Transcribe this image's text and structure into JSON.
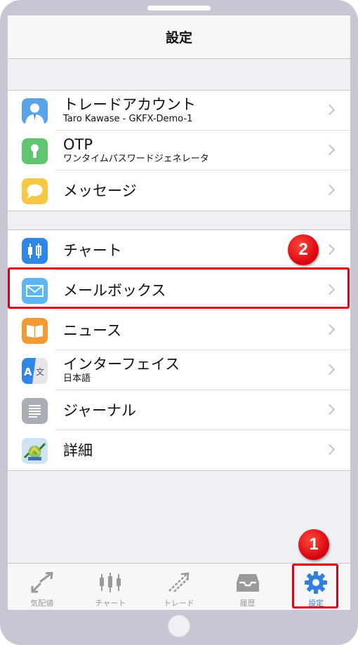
{
  "navbar": {
    "title": "設定"
  },
  "group1": [
    {
      "title": "トレードアカウント",
      "subtitle": "Taro Kawase - GKFX-Demo-1",
      "icon": "user-icon",
      "color": "#5ba3e8"
    },
    {
      "title": "OTP",
      "subtitle": "ワンタイムパスワードジェネレータ",
      "icon": "keyhole-icon",
      "color": "#5fc56f"
    },
    {
      "title": "メッセージ",
      "subtitle": "",
      "icon": "chat-bubble-icon",
      "color": "#f6c944"
    }
  ],
  "group2": [
    {
      "title": "チャート",
      "subtitle": "",
      "icon": "candlestick-icon",
      "color": "#2e87e6"
    },
    {
      "title": "メールボックス",
      "subtitle": "",
      "icon": "envelope-icon",
      "color": "#5ab7f2"
    },
    {
      "title": "ニュース",
      "subtitle": "",
      "icon": "book-icon",
      "color": "#f39a33"
    },
    {
      "title": "インターフェイス",
      "subtitle": "日本語",
      "icon": "translate-icon",
      "color": "#2e87e6"
    },
    {
      "title": "ジャーナル",
      "subtitle": "",
      "icon": "document-lines-icon",
      "color": "#a9adb6"
    },
    {
      "title": "詳細",
      "subtitle": "",
      "icon": "metatrader-icon",
      "color": "#6bb34a"
    }
  ],
  "tabbar": {
    "tabs": [
      {
        "label": "気配値",
        "icon": "quotes-arrows-icon"
      },
      {
        "label": "チャート",
        "icon": "candlestick-icon"
      },
      {
        "label": "トレード",
        "icon": "trade-arrows-icon"
      },
      {
        "label": "履歴",
        "icon": "history-tray-icon"
      },
      {
        "label": "設定",
        "icon": "gear-icon",
        "active": true
      }
    ]
  },
  "annotations": {
    "badge1": "1",
    "badge2": "2"
  },
  "colors": {
    "active_tab": "#2f7fde",
    "inactive_tab": "#9a9a9a",
    "highlight": "#e00016"
  }
}
